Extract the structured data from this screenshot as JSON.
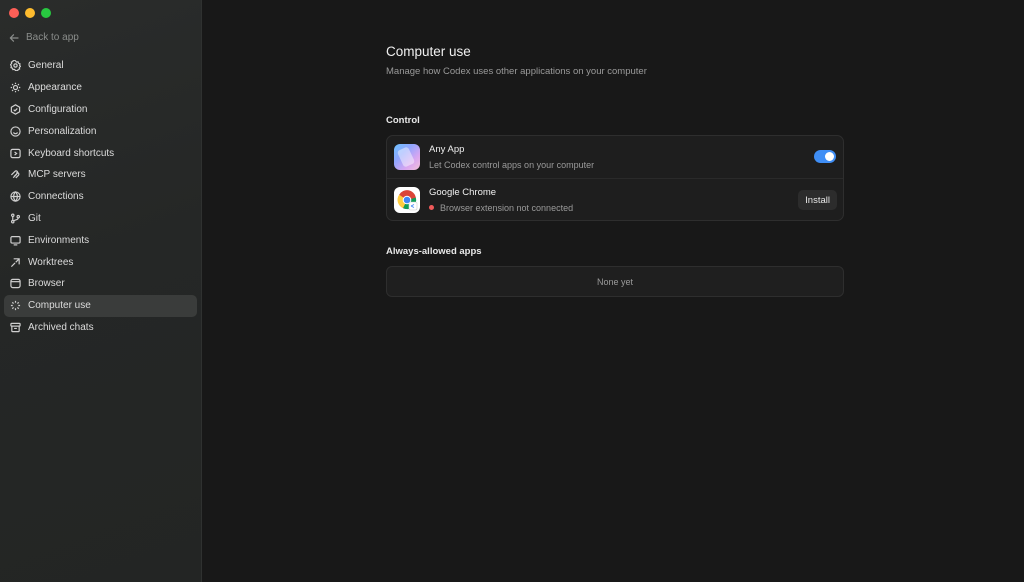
{
  "window": {
    "traffic_lights": [
      "close",
      "minimize",
      "zoom"
    ]
  },
  "sidebar": {
    "back_label": "Back to app",
    "items": [
      {
        "label": "General",
        "icon": "gear-icon"
      },
      {
        "label": "Appearance",
        "icon": "sun-icon"
      },
      {
        "label": "Configuration",
        "icon": "config-icon"
      },
      {
        "label": "Personalization",
        "icon": "smile-icon"
      },
      {
        "label": "Keyboard shortcuts",
        "icon": "keyboard-icon"
      },
      {
        "label": "MCP servers",
        "icon": "mcp-icon"
      },
      {
        "label": "Connections",
        "icon": "globe-icon"
      },
      {
        "label": "Git",
        "icon": "git-branch-icon"
      },
      {
        "label": "Environments",
        "icon": "monitor-icon"
      },
      {
        "label": "Worktrees",
        "icon": "worktree-icon"
      },
      {
        "label": "Browser",
        "icon": "browser-icon"
      },
      {
        "label": "Computer use",
        "icon": "sparkle-icon",
        "active": true
      },
      {
        "label": "Archived chats",
        "icon": "archive-icon"
      }
    ]
  },
  "page": {
    "title": "Computer use",
    "subtitle": "Manage how Codex uses other applications on your computer"
  },
  "control": {
    "label": "Control",
    "apps": [
      {
        "name": "Any App",
        "description": "Let Codex control apps on your computer",
        "toggle_on": true
      },
      {
        "name": "Google Chrome",
        "status": "Browser extension not connected",
        "status_color": "#f05a5a",
        "action": "Install"
      }
    ]
  },
  "always_allowed": {
    "label": "Always-allowed apps",
    "empty_text": "None yet"
  },
  "colors": {
    "accent": "#3f8ef5",
    "sidebar_bg": "#262827",
    "main_bg": "#181818"
  }
}
